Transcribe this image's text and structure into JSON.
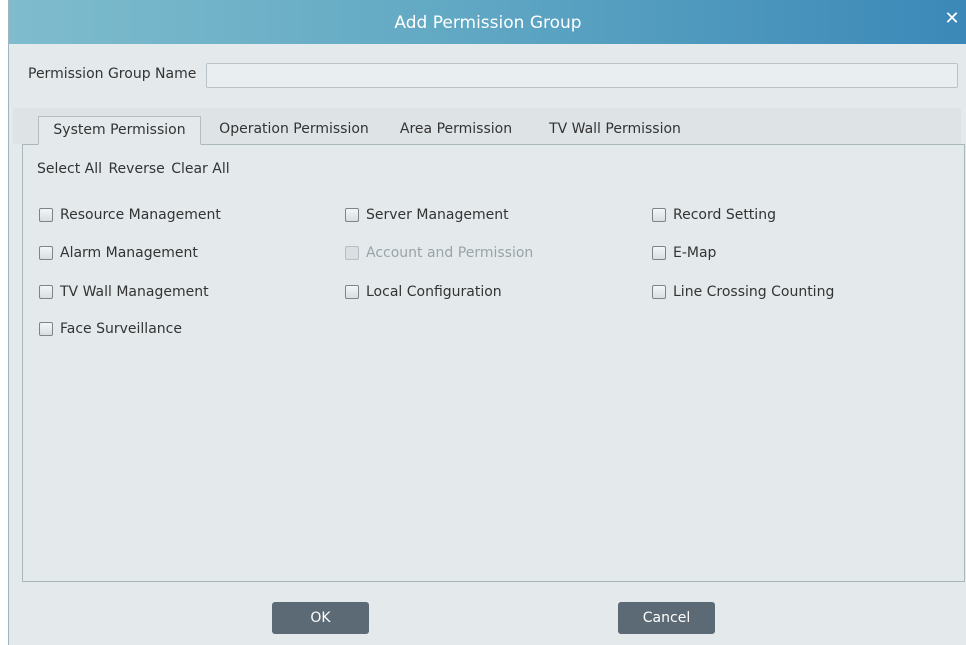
{
  "dialog": {
    "title": "Add Permission Group",
    "close_icon": "close-icon"
  },
  "group_name": {
    "label": "Permission Group Name",
    "value": "",
    "placeholder": ""
  },
  "tabs": [
    {
      "label": "System Permission",
      "active": true
    },
    {
      "label": "Operation Permission",
      "active": false
    },
    {
      "label": "Area Permission",
      "active": false
    },
    {
      "label": "TV Wall Permission",
      "active": false
    }
  ],
  "quick_actions": {
    "select_all": "Select All",
    "reverse": "Reverse",
    "clear_all": "Clear All"
  },
  "permissions": [
    {
      "label": "Resource Management",
      "checked": false,
      "enabled": true
    },
    {
      "label": "Server Management",
      "checked": false,
      "enabled": true
    },
    {
      "label": "Record Setting",
      "checked": false,
      "enabled": true
    },
    {
      "label": "Alarm Management",
      "checked": false,
      "enabled": true
    },
    {
      "label": "Account and Permission",
      "checked": false,
      "enabled": false
    },
    {
      "label": "E-Map",
      "checked": false,
      "enabled": true
    },
    {
      "label": "TV Wall Management",
      "checked": false,
      "enabled": true
    },
    {
      "label": "Local Configuration",
      "checked": false,
      "enabled": true
    },
    {
      "label": "Line Crossing Counting",
      "checked": false,
      "enabled": true
    },
    {
      "label": "Face Surveillance",
      "checked": false,
      "enabled": true
    }
  ],
  "buttons": {
    "ok": "OK",
    "cancel": "Cancel"
  },
  "colors": {
    "title_gradient_start": "#7fbccd",
    "title_gradient_end": "#3b88b8",
    "dialog_bg": "#e4eaec",
    "button_bg": "#5b6a75"
  }
}
